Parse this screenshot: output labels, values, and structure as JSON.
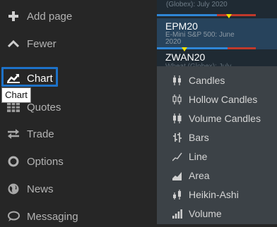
{
  "sidebar": {
    "items": [
      {
        "label": "Add page",
        "icon": "plus-icon"
      },
      {
        "label": "Fewer",
        "icon": "chevron-up-icon"
      },
      {
        "label": "Chart",
        "icon": "chart-line-icon"
      },
      {
        "label": "Quotes",
        "icon": "grid-icon"
      },
      {
        "label": "Trade",
        "icon": "arrows-exchange-icon"
      },
      {
        "label": "Options",
        "icon": "circle-icon"
      },
      {
        "label": "News",
        "icon": "globe-icon"
      },
      {
        "label": "Messaging",
        "icon": "speech-bubble-icon"
      }
    ],
    "active_item": "Chart",
    "tooltip": "Chart"
  },
  "quotes": [
    {
      "symbol": "",
      "description": "(Globex): July 2020"
    },
    {
      "symbol": "EPM20",
      "description": "E-Mini S&P 500: June 2020"
    },
    {
      "symbol": "ZWAN20",
      "description": "Wheat (Globex): July"
    }
  ],
  "chart_type_menu": {
    "items": [
      {
        "label": "Candles",
        "icon": "candles-icon"
      },
      {
        "label": "Hollow Candles",
        "icon": "hollow-candles-icon"
      },
      {
        "label": "Volume Candles",
        "icon": "volume-candles-icon"
      },
      {
        "label": "Bars",
        "icon": "bars-icon"
      },
      {
        "label": "Line",
        "icon": "line-icon"
      },
      {
        "label": "Area",
        "icon": "area-icon"
      },
      {
        "label": "Heikin-Ashi",
        "icon": "heikin-ashi-icon"
      },
      {
        "label": "Volume",
        "icon": "volume-icon"
      }
    ]
  },
  "colors": {
    "accent": "#1d72c8",
    "up": "#2f86d6",
    "down": "#c0392b",
    "marker": "#f0e000"
  }
}
